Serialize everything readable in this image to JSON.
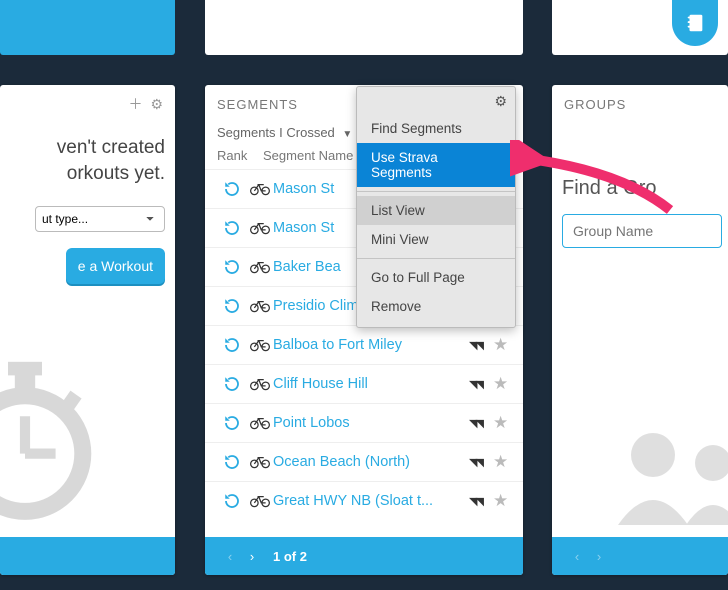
{
  "top": {
    "notebook_icon": "notebook"
  },
  "left_panel": {
    "message_line1": "ven't created",
    "message_line2": "orkouts yet.",
    "select_placeholder": "ut type...",
    "create_label": "e a Workout"
  },
  "segments_panel": {
    "title": "SEGMENTS",
    "filter_label": "Segments I Crossed",
    "col_rank": "Rank",
    "col_name": "Segment Name",
    "rows": [
      {
        "name": "Mason St"
      },
      {
        "name": "Mason St"
      },
      {
        "name": "Baker Bea"
      },
      {
        "name": "Presidio Climb"
      },
      {
        "name": "Balboa to Fort Miley"
      },
      {
        "name": "Cliff House Hill"
      },
      {
        "name": "Point Lobos"
      },
      {
        "name": "Ocean Beach (North)"
      },
      {
        "name": "Great HWY NB (Sloat t..."
      }
    ],
    "pager_label": "1 of 2"
  },
  "groups_panel": {
    "title": "GROUPS",
    "find_label": "Find a Gro",
    "input_placeholder": "Group Name"
  },
  "popover": {
    "items": [
      {
        "label": "Find Segments",
        "state": ""
      },
      {
        "label": "Use Strava Segments",
        "state": "selected"
      },
      {
        "label": "List View",
        "state": "highlight"
      },
      {
        "label": "Mini View",
        "state": ""
      },
      {
        "label": "Go to Full Page",
        "state": ""
      },
      {
        "label": "Remove",
        "state": ""
      }
    ]
  },
  "colors": {
    "accent": "#29abe2",
    "dark_bg": "#1b2a3a",
    "link": "#29abe2",
    "popover_selected": "#0a84d6",
    "arrow": "#ef2e6d"
  }
}
